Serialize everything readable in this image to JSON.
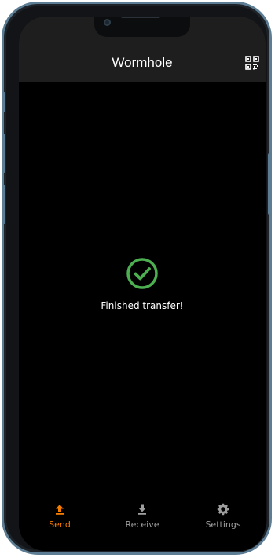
{
  "app_bar": {
    "title": "Wormhole",
    "qr_icon": "qr-code-icon"
  },
  "status": {
    "icon": "check-circle-icon",
    "message": "Finished transfer!",
    "color": "#4caf50"
  },
  "bottom_nav": {
    "items": [
      {
        "label": "Send",
        "icon": "upload-icon",
        "active": true
      },
      {
        "label": "Receive",
        "icon": "download-icon",
        "active": false
      },
      {
        "label": "Settings",
        "icon": "gear-icon",
        "active": false
      }
    ],
    "active_color": "#f57c00",
    "inactive_color": "#9e9e9e"
  }
}
